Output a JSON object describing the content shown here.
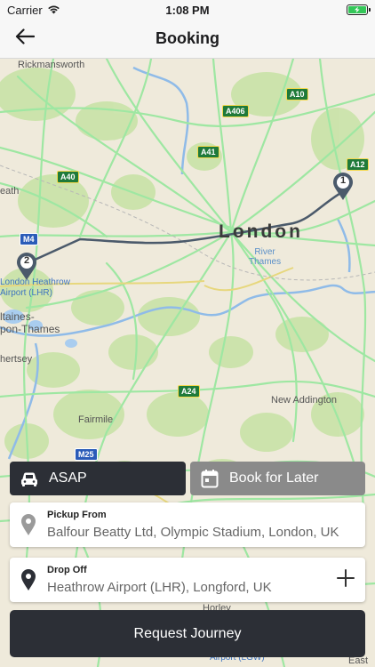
{
  "status_bar": {
    "carrier": "Carrier",
    "time": "1:08 PM",
    "battery_level": 1.0,
    "battery_color": "#34c759"
  },
  "nav": {
    "title": "Booking",
    "back_icon": "arrow-left-icon"
  },
  "map": {
    "city_label": "London",
    "river_label": "River\nThames",
    "places": {
      "rickmansworth": "Rickmansworth",
      "heath": "eath",
      "heathrow": "London Heathrow\nAirport (LHR)",
      "kingston": "ltaines-\npon-Thames",
      "chertsey": "hertsey",
      "fairmile": "Fairmile",
      "new_addington": "New Addington",
      "horley": "Horley",
      "gatwick": "Airport (LGW)",
      "east_right": "East"
    },
    "road_shields": {
      "a10": "A10",
      "a406": "A406",
      "a41": "A41",
      "a12": "A12",
      "a40": "A40",
      "m4": "M4",
      "a24": "A24",
      "m25": "M25"
    },
    "pins": [
      {
        "number": "1",
        "role": "pickup"
      },
      {
        "number": "2",
        "role": "dropoff"
      }
    ],
    "route_color": "#4b5a6b"
  },
  "booking_type": {
    "asap_label": "ASAP",
    "asap_icon": "car-icon",
    "later_label": "Book for Later",
    "later_icon": "calendar-icon",
    "selected": "ASAP"
  },
  "pickup": {
    "label": "Pickup From",
    "value": "Balfour Beatty Ltd, Olympic Stadium, London, UK",
    "icon": "location-pin-icon"
  },
  "dropoff": {
    "label": "Drop Off",
    "value": "Heathrow Airport (LHR), Longford, UK",
    "icon": "location-pin-icon",
    "add_icon": "plus-icon"
  },
  "request_button": {
    "label": "Request Journey"
  }
}
